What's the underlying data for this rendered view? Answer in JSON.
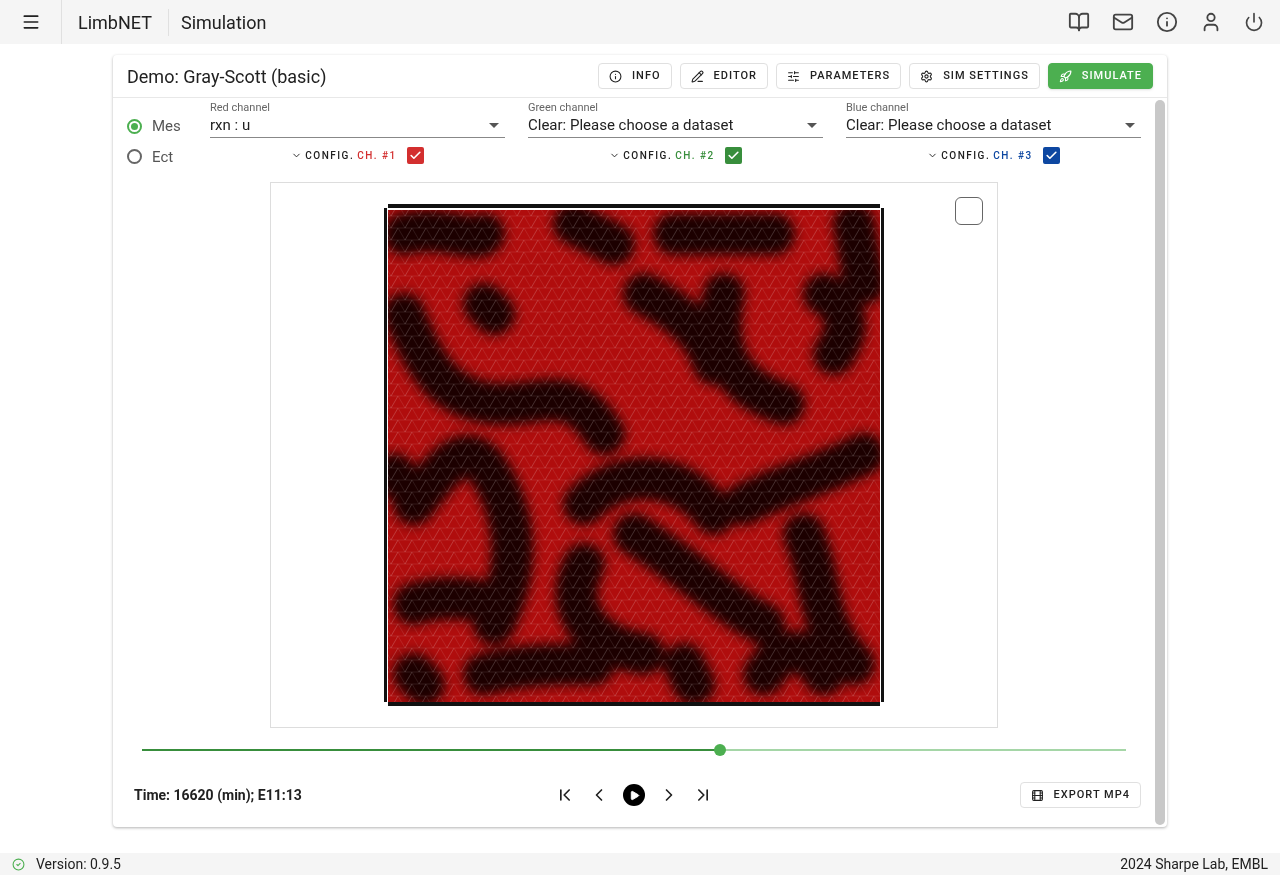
{
  "app_bar": {
    "title": "LimbNET",
    "section": "Simulation"
  },
  "card": {
    "title": "Demo: Gray-Scott (basic)",
    "buttons": [
      {
        "label": "INFO",
        "kind": "outlined"
      },
      {
        "label": "EDITOR",
        "kind": "outlined"
      },
      {
        "label": "PARAMETERS",
        "kind": "outlined"
      },
      {
        "label": "SIM SETTINGS",
        "kind": "outlined"
      },
      {
        "label": "SIMULATE",
        "kind": "primary"
      }
    ]
  },
  "radios": [
    {
      "label": "Mes",
      "selected": true
    },
    {
      "label": "Ect",
      "selected": false
    }
  ],
  "channels": [
    {
      "label": "Red channel",
      "value": "rxn : u",
      "config": "CONFIG.",
      "ch": "CH. #1",
      "checked": true,
      "color": "#d32f2f"
    },
    {
      "label": "Green channel",
      "value": "Clear: Please choose a dataset",
      "config": "CONFIG.",
      "ch": "CH. #2",
      "checked": true,
      "color": "#388e3c"
    },
    {
      "label": "Blue channel",
      "value": "Clear: Please choose a dataset",
      "config": "CONFIG.",
      "ch": "CH. #3",
      "checked": true,
      "color": "#0d47a1"
    }
  ],
  "viewer": {
    "overlay_checked": false
  },
  "timeline": {
    "level": 0.587
  },
  "time": "Time: 16620 (min); E11:13",
  "export": "EXPORT MP4",
  "status": {
    "version": "Version: 0.9.5",
    "credit": "2024 Sharpe Lab, EMBL"
  }
}
